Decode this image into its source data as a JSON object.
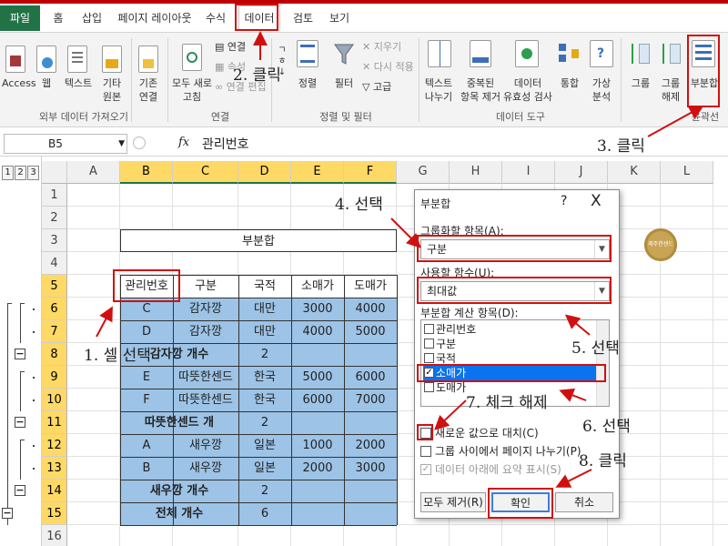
{
  "tabs": [
    "파일",
    "홈",
    "삽입",
    "페이지 레이아웃",
    "수식",
    "데이터",
    "검토",
    "보기"
  ],
  "ribbon": {
    "access": "Access",
    "web": "웹",
    "text": "텍스트",
    "other1": "기타",
    "other2": "원본",
    "existing1": "기존",
    "existing2": "연결",
    "refresh1": "모두 새로",
    "refresh2": "고침",
    "connections": "연결",
    "properties": "속성",
    "edit_links": "연결 편집",
    "sort": "정렬",
    "filter": "필터",
    "clear": "지우기",
    "reapply": "다시 적용",
    "advanced": "고급",
    "text_to_cols1": "텍스트",
    "text_to_cols2": "나누기",
    "remove_dup1": "중복된",
    "remove_dup2": "항목 제거",
    "validation1": "데이터",
    "validation2": "유효성 검사",
    "consolidate": "통합",
    "whatif1": "가상",
    "whatif2": "분석",
    "group": "그룹",
    "ungroup1": "그룹",
    "ungroup2": "해제",
    "subtotal": "부분합",
    "grp_external": "외부 데이터 가져오기",
    "grp_connections": "연결",
    "grp_sortfilter": "정렬 및 필터",
    "grp_datatools": "데이터 도구",
    "grp_outline": "윤곽선"
  },
  "formula_bar": {
    "name_box": "B5",
    "fx": "fx",
    "value": "관리번호"
  },
  "outline_levels": [
    "1",
    "2",
    "3"
  ],
  "columns": [
    "A",
    "B",
    "C",
    "D",
    "E",
    "F",
    "G",
    "H",
    "I",
    "J",
    "K",
    "L"
  ],
  "rows": [
    "1",
    "2",
    "3",
    "4",
    "5",
    "6",
    "7",
    "8",
    "9",
    "10",
    "11",
    "12",
    "13",
    "14",
    "15",
    "16"
  ],
  "sheet": {
    "title": "부분합",
    "headers": [
      "관리번호",
      "구분",
      "국적",
      "소매가",
      "도매가"
    ],
    "data": [
      [
        "C",
        "감자깡",
        "대만",
        "3000",
        "4000"
      ],
      [
        "D",
        "감자깡",
        "대만",
        "4000",
        "5000"
      ],
      [
        "",
        "감자깡 개수",
        "2",
        "",
        ""
      ],
      [
        "E",
        "따뜻한센드",
        "한국",
        "5000",
        "6000"
      ],
      [
        "F",
        "따뜻한센드",
        "한국",
        "6000",
        "7000"
      ],
      [
        "",
        "따뜻한센드 개",
        "2",
        "",
        ""
      ],
      [
        "A",
        "새우깡",
        "일본",
        "1000",
        "2000"
      ],
      [
        "B",
        "새우깡",
        "일본",
        "2000",
        "3000"
      ],
      [
        "",
        "새우깡 개수",
        "2",
        "",
        ""
      ],
      [
        "",
        "전체 개수",
        "6",
        "",
        ""
      ]
    ]
  },
  "dialog": {
    "title": "부분합",
    "help": "?",
    "close": "X",
    "group_by_label": "그룹화할 항목(A):",
    "group_by_value": "구분",
    "function_label": "사용할 함수(U):",
    "function_value": "최대값",
    "add_to_label": "부분합 계산 항목(D):",
    "items": [
      {
        "label": "관리번호",
        "checked": false
      },
      {
        "label": "구분",
        "checked": false
      },
      {
        "label": "국적",
        "checked": false
      },
      {
        "label": "소매가",
        "checked": true
      },
      {
        "label": "도매가",
        "checked": false
      }
    ],
    "replace_label": "새로운 값으로 대치(C)",
    "pagebreak_label": "그룹 사이에서 페이지 나누기(P)",
    "summary_label": "데이터 아래에 요약 표시(S)",
    "remove_all": "모두 제거(R)",
    "ok": "확인",
    "cancel": "취소"
  },
  "annotations": {
    "a1": "1. 셀 선택",
    "a2": "2. 클릭",
    "a3": "3. 클릭",
    "a4": "4. 선택",
    "a5": "5. 선택",
    "a6": "6. 선택",
    "a7": "7. 체크 해제",
    "a8": "8. 클릭"
  },
  "logo_text": "제주한센드"
}
